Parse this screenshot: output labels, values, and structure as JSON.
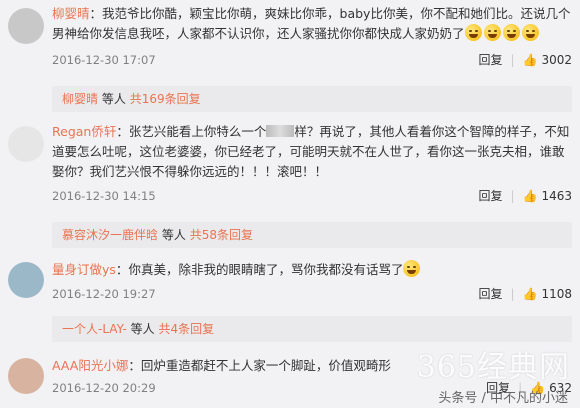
{
  "comments": [
    {
      "user": "柳婴晴",
      "text": "我范爷比你酷，颖宝比你萌，爽妹比你乖，baby比你美，你不配和她们比。还说几个男神给你发信息我呸，人家都不认识你，还人家骚扰你你都快成人家奶奶了",
      "time": "2016-12-30 17:07",
      "reply_label": "回复",
      "likes": "3002",
      "reply_user": "柳婴晴",
      "reply_mid": "等人",
      "reply_count": "共169条回复",
      "avatar_color": "#c8c8c8"
    },
    {
      "user": "Regan侨轩",
      "text_a": "张艺兴能看上你特么一个",
      "text_b": "样？再说了，其他人看着你这个智障的样子，不知道要怎么吐呢，这位老婆婆，你已经老了，可能明天就不在人世了，看你这一张克夫相，谁敢娶你？我们艺兴恨不得躲你远远的！！！滚吧！！",
      "time": "2016-12-30 14:15",
      "reply_label": "回复",
      "likes": "1463",
      "reply_user": "慕容沐汐一鹿伴晗",
      "reply_mid": "等人",
      "reply_count": "共58条回复",
      "avatar_color": "#e6e6e6"
    },
    {
      "user": "量身订做ys",
      "text": "你真美，除非我的眼睛瞎了，骂你我都没有话骂了",
      "time": "2016-12-20 19:27",
      "reply_label": "回复",
      "likes": "1108",
      "reply_user": "一个人-LAY-",
      "reply_mid": "等人",
      "reply_count": "共4条回复",
      "avatar_color": "#9bb8c9"
    },
    {
      "user": "AAA阳光小娜",
      "text": "回炉重造都赶不上人家一个脚趾，价值观畸形",
      "time": "2016-12-20 20:29",
      "reply_label": "回复",
      "likes": "632",
      "avatar_color": "#d8b4a0"
    }
  ],
  "watermark": "365经典网",
  "watermark_sub": "头条号 / 中不凡的小迷",
  "icons": [
    "like-icon",
    "emoji-icon"
  ]
}
